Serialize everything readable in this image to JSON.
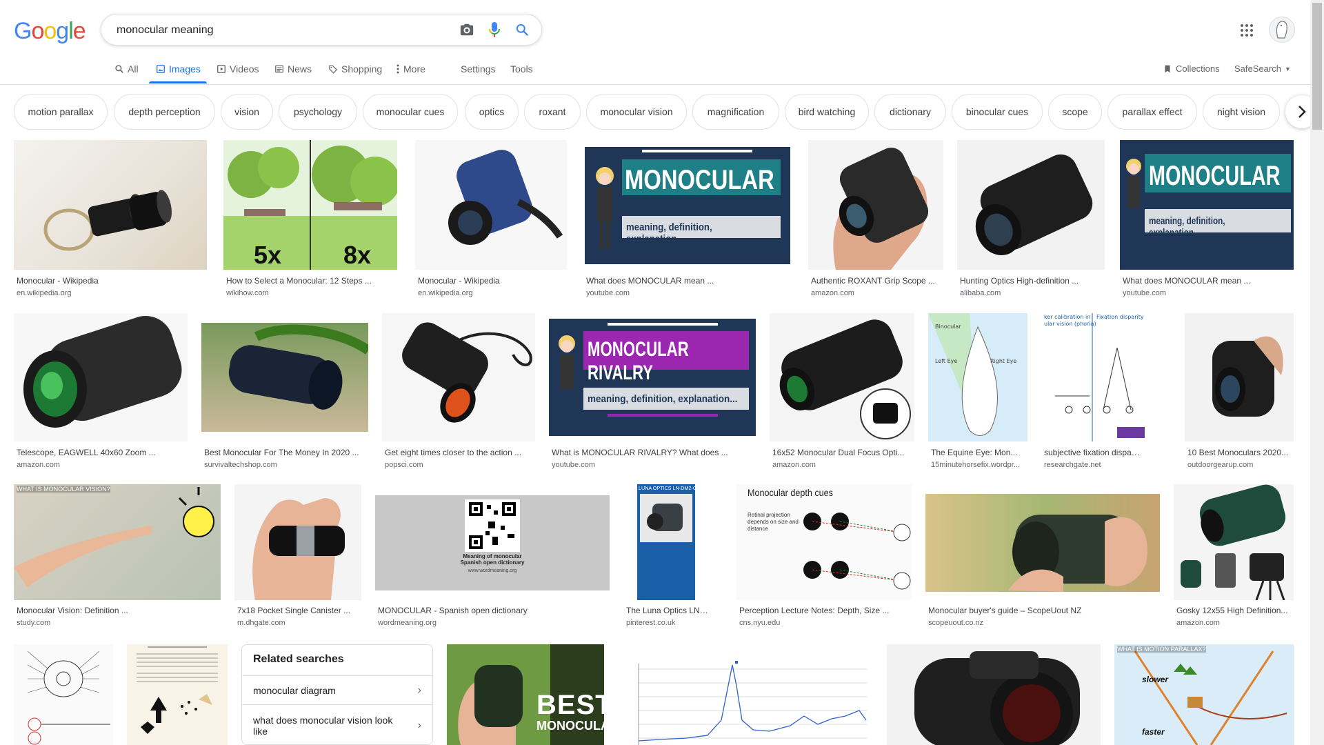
{
  "search": {
    "query": "monocular meaning"
  },
  "tabs": [
    {
      "label": "All"
    },
    {
      "label": "Images"
    },
    {
      "label": "Videos"
    },
    {
      "label": "News"
    },
    {
      "label": "Shopping"
    },
    {
      "label": "More"
    }
  ],
  "tools": {
    "settings": "Settings",
    "tools": "Tools",
    "collections": "Collections",
    "safesearch": "SafeSearch"
  },
  "chips": [
    "motion parallax",
    "depth perception",
    "vision",
    "psychology",
    "monocular cues",
    "optics",
    "roxant",
    "monocular vision",
    "magnification",
    "bird watching",
    "dictionary",
    "binocular cues",
    "scope",
    "parallax effect",
    "night vision"
  ],
  "results": [
    {
      "title": "Monocular - Wikipedia",
      "source": "en.wikipedia.org"
    },
    {
      "title": "How to Select a Monocular: 12 Steps ...",
      "source": "wikihow.com"
    },
    {
      "title": "Monocular - Wikipedia",
      "source": "en.wikipedia.org"
    },
    {
      "title": "What does MONOCULAR mean ...",
      "source": "youtube.com"
    },
    {
      "title": "Authentic ROXANT Grip Scope ...",
      "source": "amazon.com"
    },
    {
      "title": "Hunting Optics High-definition ...",
      "source": "alibaba.com"
    },
    {
      "title": "What does MONOCULAR mean ...",
      "source": "youtube.com"
    },
    {
      "title": "Telescope, EAGWELL 40x60 Zoom ...",
      "source": "amazon.com"
    },
    {
      "title": "Best Monocular For The Money In 2020 ...",
      "source": "survivaltechshop.com"
    },
    {
      "title": "Get eight times closer to the action ...",
      "source": "popsci.com"
    },
    {
      "title": "What is MONOCULAR RIVALRY? What does ...",
      "source": "youtube.com"
    },
    {
      "title": "16x52 Monocular Dual Focus Opti...",
      "source": "amazon.com"
    },
    {
      "title": "The Equine Eye: Mon...",
      "source": "15minutehorsefix.wordpr..."
    },
    {
      "title": "subjective fixation disparity ...",
      "source": "researchgate.net"
    },
    {
      "title": "10 Best Monoculars 2020...",
      "source": "outdoorgearup.com"
    },
    {
      "title": "Monocular Vision: Definition ...",
      "source": "study.com"
    },
    {
      "title": "7x18 Pocket Single Canister ...",
      "source": "m.dhgate.com"
    },
    {
      "title": "MONOCULAR - Spanish open dictionary",
      "source": "wordmeaning.org"
    },
    {
      "title": "The Luna Optics LN-D...",
      "source": "pinterest.co.uk"
    },
    {
      "title": "Perception Lecture Notes: Depth, Size ...",
      "source": "cns.nyu.edu"
    },
    {
      "title": "Monocular buyer's guide – ScopeUout NZ",
      "source": "scopeuout.co.nz"
    },
    {
      "title": "Gosky 12x55 High Definition...",
      "source": "amazon.com"
    }
  ],
  "thumb_text": {
    "monocular": "MONOCULAR",
    "meaning": "meaning, definition, explanation...",
    "rivalry": "MONOCULAR RIVALRY",
    "five_x": "5x",
    "eight_x": "8x",
    "depth_cues": "Monocular depth cues",
    "retinal": "Retinal projection depends on size and distance",
    "meaning_of": "Meaning of monocular Spanish open dictionary",
    "wordmeaning": "www.wordmeaning.org",
    "luna": "LUNA OPTICS LN-DM2-C",
    "what_is": "WHAT IS MONOCULAR VISION?",
    "best": "BEST",
    "best_mono": "MONOCULAR",
    "motion": "WHAT IS MOTION PARALLAX?",
    "slower": "slower",
    "faster": "faster"
  },
  "related": {
    "heading": "Related searches",
    "items": [
      "monocular diagram",
      "what does monocular vision look like"
    ]
  },
  "colors": {
    "accent": "#1a73e8",
    "g_blue": "#4285f4",
    "g_red": "#ea4335",
    "g_yellow": "#fbbc05",
    "g_green": "#34a853"
  }
}
